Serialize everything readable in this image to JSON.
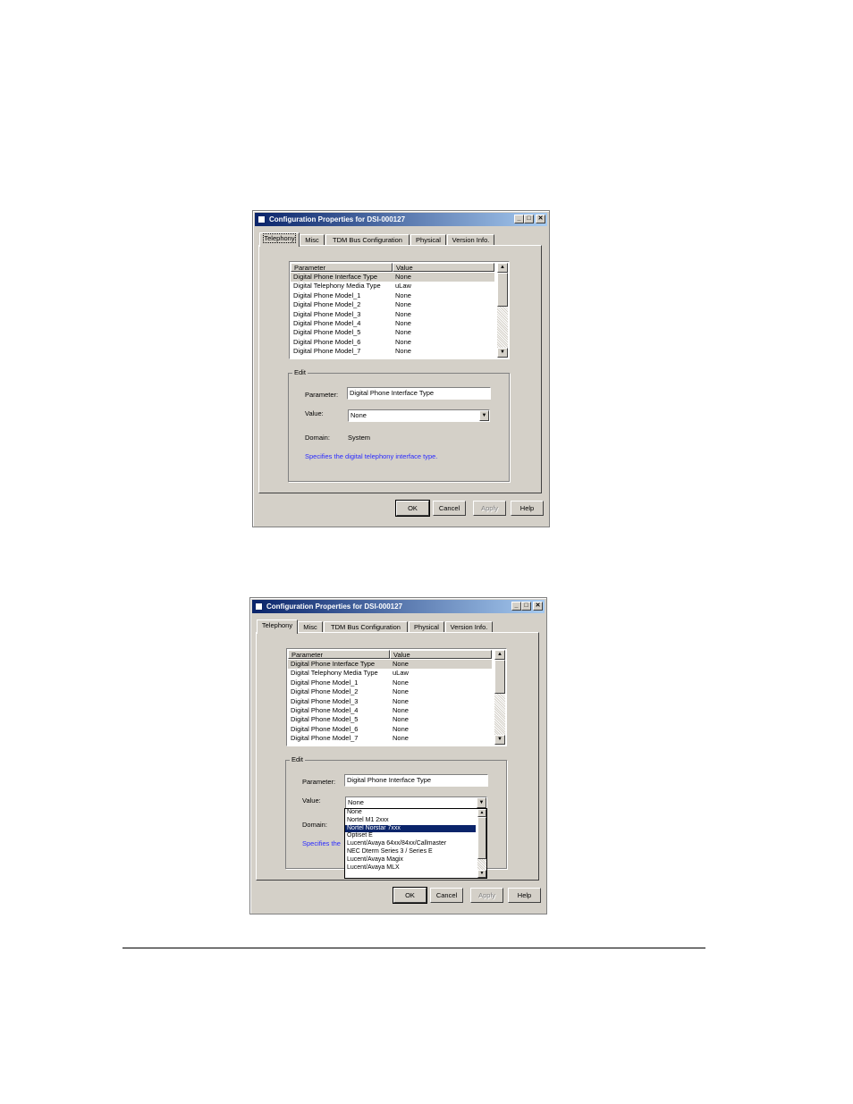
{
  "dialogs": [
    {
      "title": "Configuration Properties for DSI-000127",
      "window_buttons": {
        "minimize": "_",
        "maximize": "□",
        "close": "✕"
      },
      "tabs": [
        "Telephony",
        "Misc",
        "TDM Bus Configuration",
        "Physical",
        "Version Info."
      ],
      "active_tab": "Telephony",
      "list": {
        "headers": [
          "Parameter",
          "Value"
        ],
        "rows": [
          {
            "param": "Digital Phone Interface Type",
            "value": "None"
          },
          {
            "param": "Digital Telephony Media Type",
            "value": "uLaw"
          },
          {
            "param": "Digital Phone Model_1",
            "value": "None"
          },
          {
            "param": "Digital Phone Model_2",
            "value": "None"
          },
          {
            "param": "Digital Phone Model_3",
            "value": "None"
          },
          {
            "param": "Digital Phone Model_4",
            "value": "None"
          },
          {
            "param": "Digital Phone Model_5",
            "value": "None"
          },
          {
            "param": "Digital Phone Model_6",
            "value": "None"
          },
          {
            "param": "Digital Phone Model_7",
            "value": "None"
          }
        ]
      },
      "edit": {
        "group_label": "Edit",
        "parameter_label": "Parameter:",
        "parameter_value": "Digital Phone Interface Type",
        "value_label": "Value:",
        "value_selected": "None",
        "domain_label": "Domain:",
        "domain_value": "System",
        "description": "Specifies the digital telephony interface type."
      },
      "buttons": {
        "ok": "OK",
        "cancel": "Cancel",
        "apply": "Apply",
        "help": "Help"
      }
    },
    {
      "title": "Configuration Properties for DSI-000127",
      "window_buttons": {
        "minimize": "_",
        "maximize": "□",
        "close": "✕"
      },
      "tabs": [
        "Telephony",
        "Misc",
        "TDM Bus Configuration",
        "Physical",
        "Version Info."
      ],
      "active_tab": "Telephony",
      "list": {
        "headers": [
          "Parameter",
          "Value"
        ],
        "rows": [
          {
            "param": "Digital Phone Interface Type",
            "value": "None"
          },
          {
            "param": "Digital Telephony Media Type",
            "value": "uLaw"
          },
          {
            "param": "Digital Phone Model_1",
            "value": "None"
          },
          {
            "param": "Digital Phone Model_2",
            "value": "None"
          },
          {
            "param": "Digital Phone Model_3",
            "value": "None"
          },
          {
            "param": "Digital Phone Model_4",
            "value": "None"
          },
          {
            "param": "Digital Phone Model_5",
            "value": "None"
          },
          {
            "param": "Digital Phone Model_6",
            "value": "None"
          },
          {
            "param": "Digital Phone Model_7",
            "value": "None"
          }
        ]
      },
      "edit": {
        "group_label": "Edit",
        "parameter_label": "Parameter:",
        "parameter_value": "Digital Phone Interface Type",
        "value_label": "Value:",
        "value_selected": "None",
        "domain_label": "Domain:",
        "description_partial": "Specifies the"
      },
      "dropdown_options": [
        "None",
        "Nortel M1 2xxx",
        "Nortel Norstar 7xxx",
        "Optiset E",
        "Lucent/Avaya 64xx/84xx/Callmaster",
        "NEC Dterm Series 3 / Series E",
        "Lucent/Avaya Magix",
        "Lucent/Avaya MLX"
      ],
      "dropdown_highlighted": "Nortel Norstar 7xxx",
      "buttons": {
        "ok": "OK",
        "cancel": "Cancel",
        "apply": "Apply",
        "help": "Help"
      }
    }
  ],
  "colors": {
    "dialog_bg": "#d4d0c8",
    "title_bar": "#0a246a",
    "selection": "#0a246a",
    "description_text": "#2a2aff"
  }
}
